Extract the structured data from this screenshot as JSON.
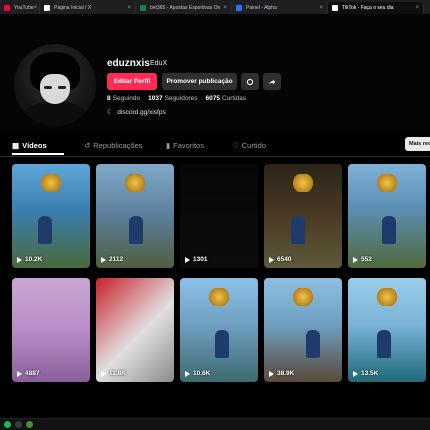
{
  "browser": {
    "tabs": [
      {
        "label": "YouTube",
        "fav": "#ff0033",
        "active": false
      },
      {
        "label": "Página Inicial / X",
        "fav": "#ffffff",
        "active": false
      },
      {
        "label": "bet365 - Apostas Esportivas On",
        "fav": "#1a7f4a",
        "active": false
      },
      {
        "label": "Painel - Alpha",
        "fav": "#2b6fff",
        "active": false
      },
      {
        "label": "TikTok - Faça o seu dia",
        "fav": "#ffffff",
        "active": true
      }
    ]
  },
  "profile": {
    "username": "eduznxis",
    "nickname": "EduX",
    "edit_button": "Editar Perfil",
    "promo_button": "Promover publicação",
    "stats": [
      {
        "value": "8",
        "label": "Seguindo"
      },
      {
        "value": "1037",
        "label": "Seguidores"
      },
      {
        "value": "6075",
        "label": "Curtidas"
      }
    ],
    "link": "discord.gg/xisfps"
  },
  "tabs": {
    "videos": "Vídeos",
    "reposts": "Republicações",
    "favorites": "Favoritos",
    "liked": "Curtido",
    "sort": "Mais rec"
  },
  "videos": [
    {
      "views": "10.2K",
      "bg": "linear-gradient(180deg,#5fa7d8 0%,#3a7fb0 45%,#4a6a3a 100%)",
      "emblem": true
    },
    {
      "views": "2112",
      "bg": "linear-gradient(180deg,#7fa9c9 0%,#5b7e9a 50%,#4f5f3e 100%)",
      "emblem": true
    },
    {
      "views": "1301",
      "bg": "linear-gradient(180deg,#070707 0%,#0c0c0c 100%)",
      "emblem": false
    },
    {
      "views": "6540",
      "bg": "linear-gradient(180deg,#2b2418 0%,#4a3a24 50%,#5c5a3a 100%)",
      "emblem": true
    },
    {
      "views": "552",
      "bg": "linear-gradient(180deg,#7fb0d8 0%,#5d8fb7 40%,#4f6b3e 100%)",
      "emblem": true
    },
    {
      "views": "4887",
      "bg": "linear-gradient(180deg,#c9a7d4 0%,#b88cc7 50%,#8a5f9a 100%)",
      "emblem": false
    },
    {
      "views": "11.8K",
      "bg": "linear-gradient(135deg,#c8202a 0%,#e0e0e0 55%,#8a8a8a 100%)",
      "emblem": false
    },
    {
      "views": "10.6K",
      "bg": "linear-gradient(180deg,#8cc0e6 0%,#6f9fc2 45%,#3d6b6f 100%)",
      "emblem": true
    },
    {
      "views": "38.9K",
      "bg": "linear-gradient(180deg,#8fbfe0 0%,#6e9fc0 45%,#5a4a3a 100%)",
      "emblem": true
    },
    {
      "views": "13.5K",
      "bg": "linear-gradient(180deg,#9bcde8 0%,#7ab2d6 45%,#1f6a7a 100%)",
      "emblem": true
    }
  ]
}
